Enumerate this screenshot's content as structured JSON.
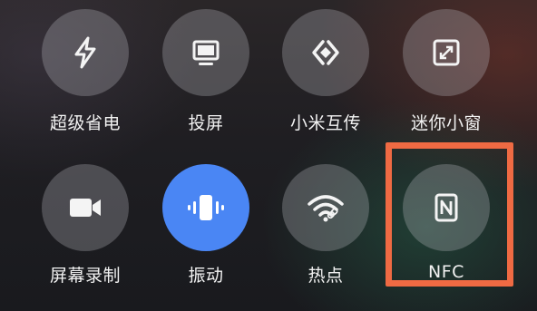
{
  "tiles": [
    {
      "id": "power-saver",
      "label": "超级省电",
      "icon": "lightning-icon",
      "active": false
    },
    {
      "id": "cast",
      "label": "投屏",
      "icon": "monitor-icon",
      "active": false
    },
    {
      "id": "share",
      "label": "小米互传",
      "icon": "share-transfer-icon",
      "active": false
    },
    {
      "id": "mini-window",
      "label": "迷你小窗",
      "icon": "mini-window-icon",
      "active": false
    },
    {
      "id": "screen-record",
      "label": "屏幕录制",
      "icon": "video-camera-icon",
      "active": false
    },
    {
      "id": "vibrate",
      "label": "振动",
      "icon": "vibrate-icon",
      "active": true
    },
    {
      "id": "hotspot",
      "label": "热点",
      "icon": "wifi-hotspot-icon",
      "active": false
    },
    {
      "id": "nfc",
      "label": "NFC",
      "icon": "nfc-icon",
      "active": false
    }
  ],
  "colors": {
    "active": "#4a86f4",
    "highlight": "#ef6a43"
  },
  "highlighted_tile": "nfc"
}
